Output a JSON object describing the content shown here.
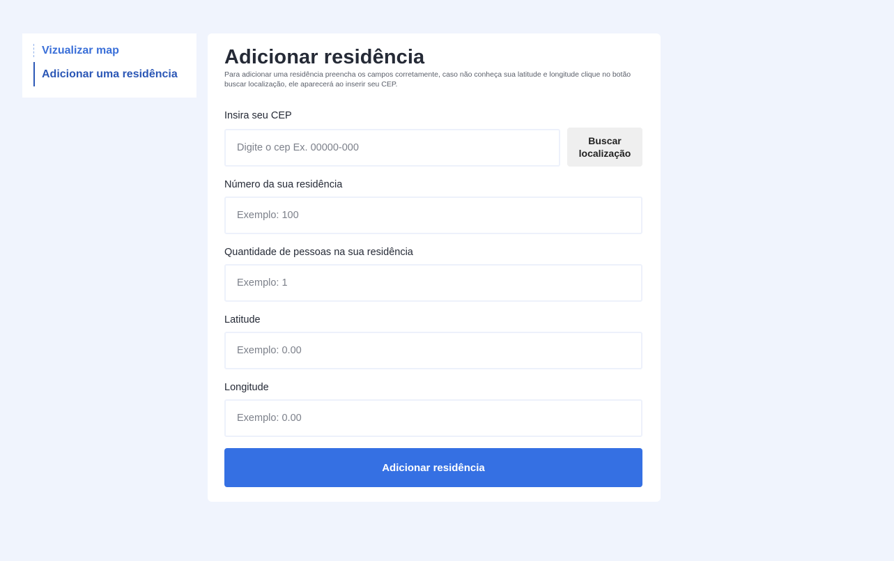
{
  "sidebar": {
    "items": [
      {
        "label": "Vizualizar map"
      },
      {
        "label": "Adicionar uma residência"
      }
    ]
  },
  "main": {
    "title": "Adicionar residência",
    "subtitle": "Para adicionar uma residência preencha os campos corretamente, caso não conheça sua latitude e longitude clique no botão buscar localização, ele aparecerá ao inserir seu CEP.",
    "fields": {
      "cep": {
        "label": "Insira seu CEP",
        "placeholder": "Digite o cep Ex. 00000-000",
        "value": ""
      },
      "numero": {
        "label": "Número da sua residência",
        "placeholder": "Exemplo: 100",
        "value": ""
      },
      "pessoas": {
        "label": "Quantidade de pessoas na sua residência",
        "placeholder": "Exemplo: 1",
        "value": ""
      },
      "latitude": {
        "label": "Latitude",
        "placeholder": "Exemplo: 0.00",
        "value": ""
      },
      "longitude": {
        "label": "Longitude",
        "placeholder": "Exemplo: 0.00",
        "value": ""
      }
    },
    "search_button_label": "Buscar localização",
    "submit_button_label": "Adicionar residência"
  },
  "colors": {
    "background": "#f0f4fd",
    "primary": "#3570e3",
    "nav_link": "#3a6fd8",
    "nav_active": "#2b57b6",
    "secondary_button": "#efefef"
  }
}
